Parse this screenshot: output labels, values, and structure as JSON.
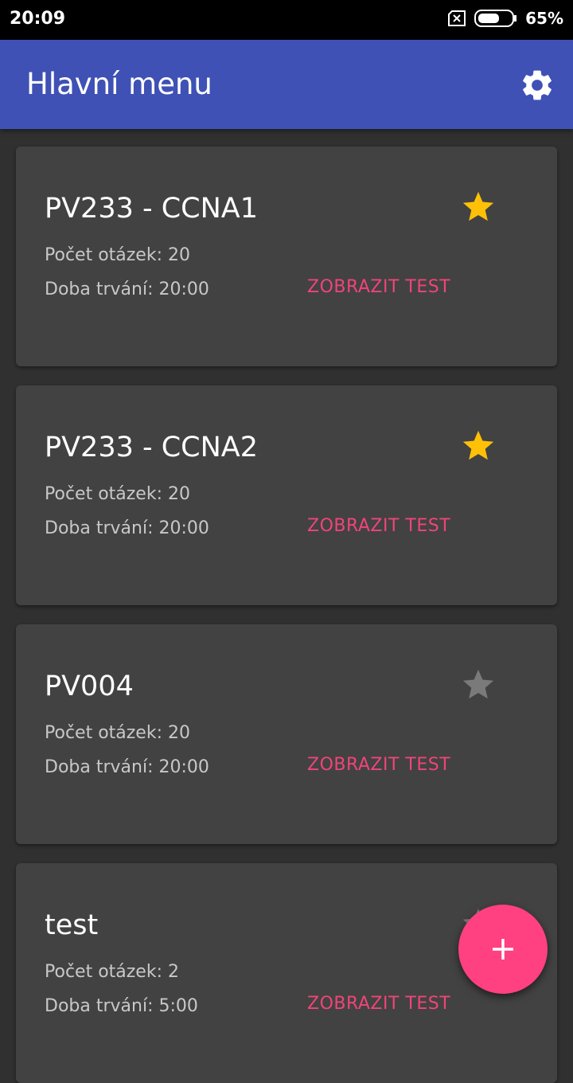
{
  "status_bar": {
    "time": "20:09",
    "battery_percent": "65%",
    "battery_level": 0.65,
    "sim_icon": "no-sim-icon",
    "battery_icon": "battery-icon"
  },
  "app_bar": {
    "title": "Hlavní menu",
    "settings_icon": "gear-icon",
    "color": "#3f51b5"
  },
  "tests": [
    {
      "title": "PV233 - CCNA1",
      "questions": "Počet otázek: 20",
      "duration": "Doba trvání: 20:00",
      "action": "ZOBRAZIT TEST",
      "favorite": true
    },
    {
      "title": "PV233 - CCNA2",
      "questions": "Počet otázek: 20",
      "duration": "Doba trvání: 20:00",
      "action": "ZOBRAZIT TEST",
      "favorite": true
    },
    {
      "title": "PV004",
      "questions": "Počet otázek: 20",
      "duration": "Doba trvání: 20:00",
      "action": "ZOBRAZIT TEST",
      "favorite": false
    },
    {
      "title": "test",
      "questions": "Počet otázek: 2",
      "duration": "Doba trvání: 5:00",
      "action": "ZOBRAZIT TEST",
      "favorite": false
    }
  ],
  "fab": {
    "icon": "plus-icon",
    "color": "#ff4081"
  },
  "colors": {
    "background": "#303030",
    "card": "#424242",
    "accent": "#f0447a",
    "star_active": "#ffc107",
    "star_inactive": "#7a7a7a"
  }
}
